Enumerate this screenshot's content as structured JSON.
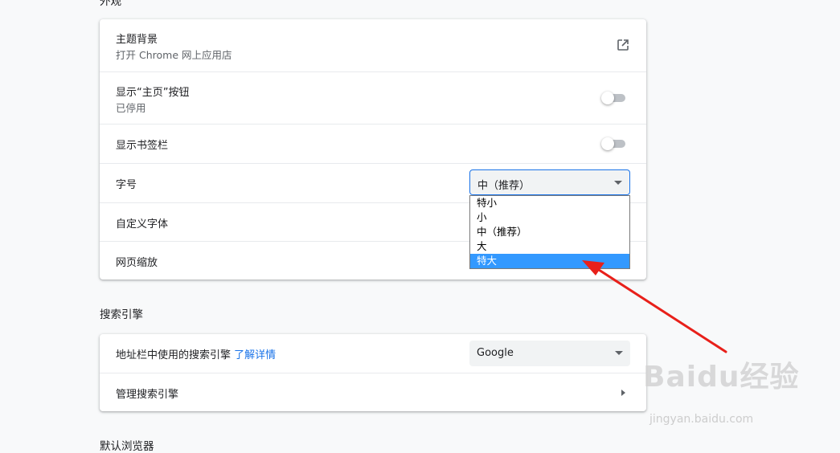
{
  "appearance": {
    "section_title": "外观",
    "theme": {
      "label": "主题背景",
      "sub": "打开 Chrome 网上应用店"
    },
    "home_button": {
      "label": "显示“主页”按钮",
      "sub": "已停用",
      "enabled": false
    },
    "bookmarks_bar": {
      "label": "显示书签栏",
      "enabled": false
    },
    "font_size": {
      "label": "字号",
      "selected": "中（推荐）",
      "options": [
        "特小",
        "小",
        "中（推荐）",
        "大",
        "特大"
      ],
      "highlighted": "特大"
    },
    "custom_fonts": {
      "label": "自定义字体"
    },
    "page_zoom": {
      "label": "网页缩放"
    }
  },
  "search_engine": {
    "section_title": "搜索引擎",
    "address_bar": {
      "label": "地址栏中使用的搜索引擎",
      "link": "了解详情",
      "selected": "Google"
    },
    "manage": {
      "label": "管理搜索引擎"
    }
  },
  "default_browser": {
    "section_title": "默认浏览器"
  },
  "watermark": {
    "logo": "Baidu经验",
    "url": "jingyan.baidu.com"
  },
  "colors": {
    "accent": "#1a73e8",
    "highlight": "#3399ff",
    "arrow": "#e8201a"
  }
}
